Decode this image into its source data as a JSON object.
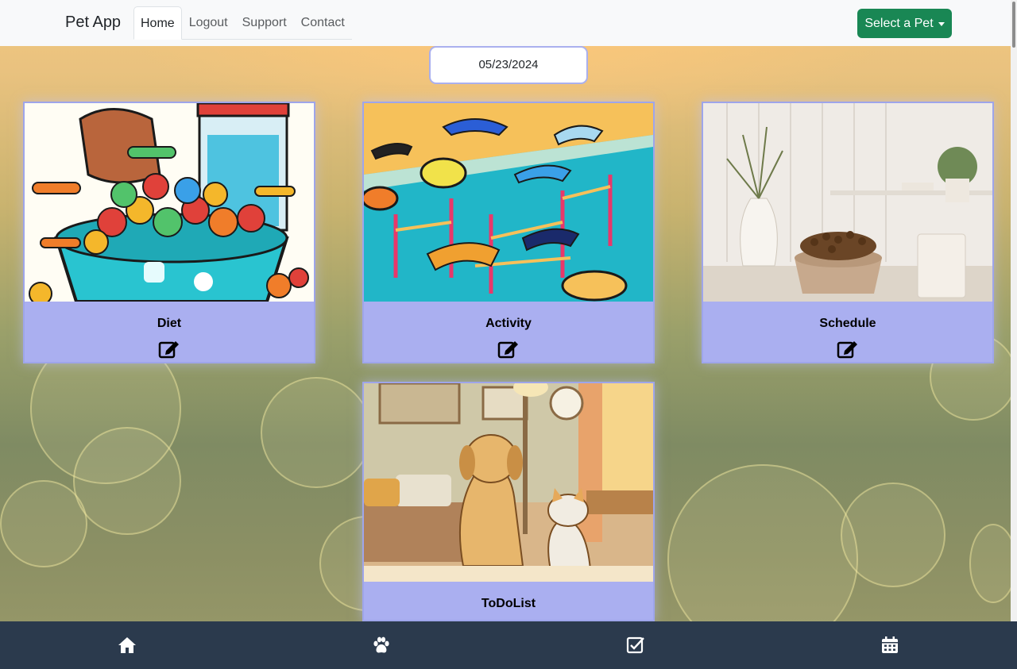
{
  "navbar": {
    "brand": "Pet App",
    "links": [
      {
        "label": "Home",
        "active": true
      },
      {
        "label": "Logout"
      },
      {
        "label": "Support"
      },
      {
        "label": "Contact"
      }
    ],
    "select_pet_label": "Select a Pet"
  },
  "date": {
    "value": "05/23/2024"
  },
  "cards": [
    {
      "title": "Diet",
      "image": "dog-food-bowl-illustration",
      "action_icon": "edit-icon"
    },
    {
      "title": "Activity",
      "image": "dog-agility-course-illustration",
      "action_icon": "edit-icon"
    },
    {
      "title": "Schedule",
      "image": "food-bowl-kitchen-photo",
      "action_icon": "edit-icon"
    },
    {
      "title": "ToDoList",
      "image": "dog-and-cat-living-room-illustration",
      "action_icon": "edit-icon"
    }
  ],
  "bottom_nav": {
    "icons": [
      "home-icon",
      "paw-icon",
      "checkbox-icon",
      "calendar-icon"
    ]
  },
  "colors": {
    "navbar_bg": "#f8f9fa",
    "select_button": "#198754",
    "card_bg": "#aaaff0",
    "bottom_bar": "#2b3a4d"
  }
}
